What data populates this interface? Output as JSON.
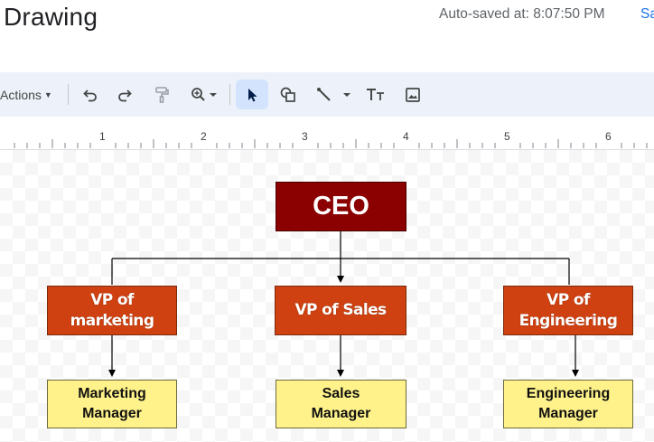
{
  "header": {
    "title": "Drawing",
    "autosave": "Auto-saved at: 8:07:50 PM",
    "save_link": "Sa"
  },
  "toolbar": {
    "actions_label": "Actions",
    "tools": [
      {
        "name": "undo-icon"
      },
      {
        "name": "redo-icon"
      },
      {
        "name": "paint-format-icon"
      },
      {
        "name": "zoom-icon"
      },
      {
        "name": "select-icon",
        "active": true
      },
      {
        "name": "shape-icon"
      },
      {
        "name": "line-icon"
      },
      {
        "name": "text-box-icon"
      },
      {
        "name": "image-icon"
      }
    ]
  },
  "ruler": {
    "labels": [
      "1",
      "2",
      "3",
      "4",
      "5",
      "6"
    ]
  },
  "chart": {
    "ceo": "CEO",
    "vps": [
      "VP of\nmarketing",
      "VP of Sales",
      "VP of\nEngineering"
    ],
    "managers": [
      "Marketing\nManager",
      "Sales\nManager",
      "Engineering\nManager"
    ]
  },
  "colors": {
    "ceo_fill": "#8b0000",
    "vp_fill": "#cf4110",
    "manager_fill": "#fff28a",
    "toolbar_bg": "#edf2fa",
    "active_tool_bg": "#d3e3fd",
    "link": "#1a73e8"
  }
}
